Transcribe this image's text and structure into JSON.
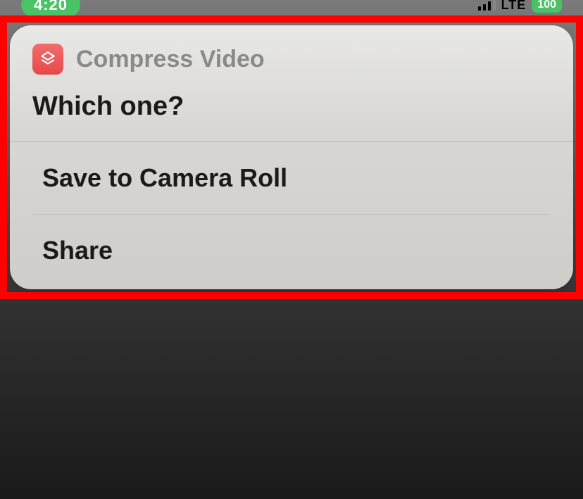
{
  "status_bar": {
    "time": "4:20",
    "network": "LTE",
    "battery": "100"
  },
  "sheet": {
    "app_name": "Compress Video",
    "question": "Which one?",
    "options": [
      {
        "label": "Save to Camera Roll"
      },
      {
        "label": "Share"
      }
    ]
  },
  "icons": {
    "app_icon": "compress-icon"
  }
}
